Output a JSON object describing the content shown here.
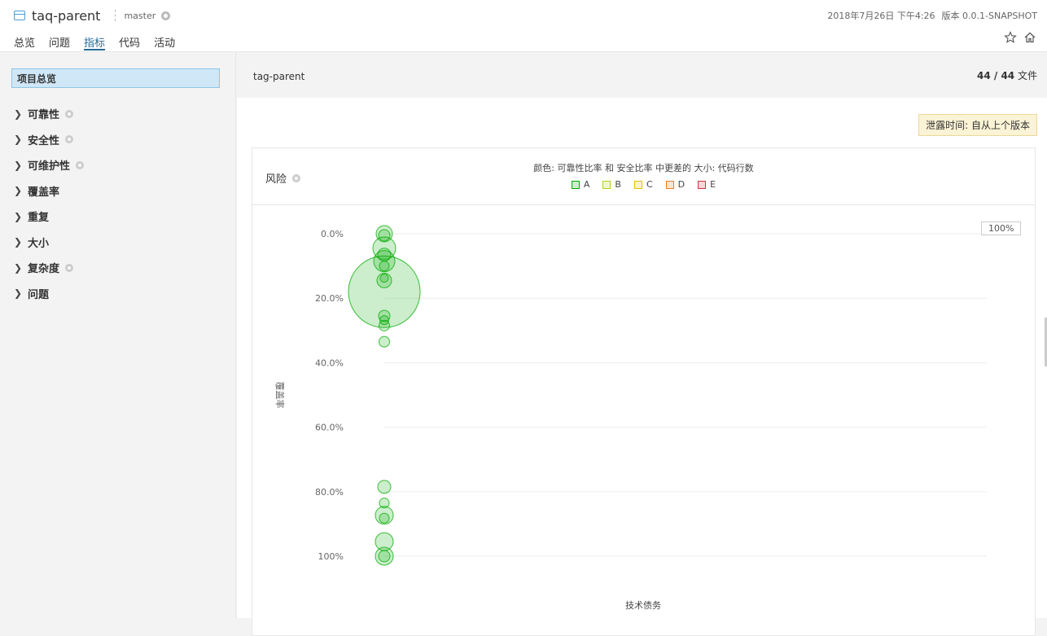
{
  "header": {
    "project_name": "taq-parent",
    "branch": "master",
    "date": "2018年7月26日 下午4:26",
    "version": "版本 0.0.1-SNAPSHOT"
  },
  "nav": [
    "总览",
    "问题",
    "指标",
    "代码",
    "活动"
  ],
  "sidebar": {
    "overview": "项目总览",
    "items": [
      {
        "label": "可靠性",
        "help": true
      },
      {
        "label": "安全性",
        "help": true
      },
      {
        "label": "可维护性",
        "help": true
      },
      {
        "label": "覆盖率",
        "help": false
      },
      {
        "label": "重复",
        "help": false
      },
      {
        "label": "大小",
        "help": false
      },
      {
        "label": "复杂度",
        "help": true
      },
      {
        "label": "问题",
        "help": false
      }
    ]
  },
  "main": {
    "title": "tag-parent",
    "files_count": "44 / 44",
    "files_label": "文件",
    "leak_period": "泄露时间: 自从上个版本"
  },
  "risk": {
    "title": "风险",
    "legend_desc": "颜色: 可靠性比率 和 安全比率 中更差的  大小: 代码行数",
    "zoom": "100%"
  },
  "colors": {
    "A": "#00aa00",
    "B": "#b0d513",
    "C": "#eabe06",
    "D": "#ed7d20",
    "E": "#d4333f",
    "accent": "#236a97"
  },
  "chart_data": {
    "type": "scatter",
    "xlabel": "技术债务",
    "ylabel": "覆盖率",
    "y_tick_labels": [
      "0.0%",
      "20.0%",
      "40.0%",
      "60.0%",
      "80.0%",
      "100%"
    ],
    "ylim": [
      0,
      100
    ],
    "y_inverted": true,
    "legend": [
      "A",
      "B",
      "C",
      "D",
      "E"
    ],
    "points": [
      {
        "x": 0,
        "y": 0,
        "size": 20,
        "rating": "A"
      },
      {
        "x": 0,
        "y": 0.5,
        "size": 14,
        "rating": "A"
      },
      {
        "x": 0,
        "y": 4.5,
        "size": 28,
        "rating": "A"
      },
      {
        "x": 0,
        "y": 6.5,
        "size": 16,
        "rating": "A"
      },
      {
        "x": 0,
        "y": 8.5,
        "size": 26,
        "rating": "A"
      },
      {
        "x": 0,
        "y": 10,
        "size": 12,
        "rating": "A"
      },
      {
        "x": 0,
        "y": 14.5,
        "size": 18,
        "rating": "A"
      },
      {
        "x": 0,
        "y": 13.8,
        "size": 10,
        "rating": "A"
      },
      {
        "x": 0,
        "y": 18,
        "size": 88,
        "rating": "A"
      },
      {
        "x": 0,
        "y": 25.5,
        "size": 14,
        "rating": "A"
      },
      {
        "x": 0,
        "y": 26.8,
        "size": 11,
        "rating": "A"
      },
      {
        "x": 0,
        "y": 28.5,
        "size": 13,
        "rating": "A"
      },
      {
        "x": 0,
        "y": 33.5,
        "size": 13,
        "rating": "A"
      },
      {
        "x": 0,
        "y": 78.5,
        "size": 16,
        "rating": "A"
      },
      {
        "x": 0,
        "y": 83.5,
        "size": 12,
        "rating": "A"
      },
      {
        "x": 0,
        "y": 87.3,
        "size": 22,
        "rating": "A"
      },
      {
        "x": 0,
        "y": 88.2,
        "size": 12,
        "rating": "A"
      },
      {
        "x": 0,
        "y": 95.5,
        "size": 22,
        "rating": "A"
      },
      {
        "x": 0,
        "y": 100,
        "size": 22,
        "rating": "A"
      },
      {
        "x": 0,
        "y": 100,
        "size": 14,
        "rating": "A"
      }
    ]
  }
}
